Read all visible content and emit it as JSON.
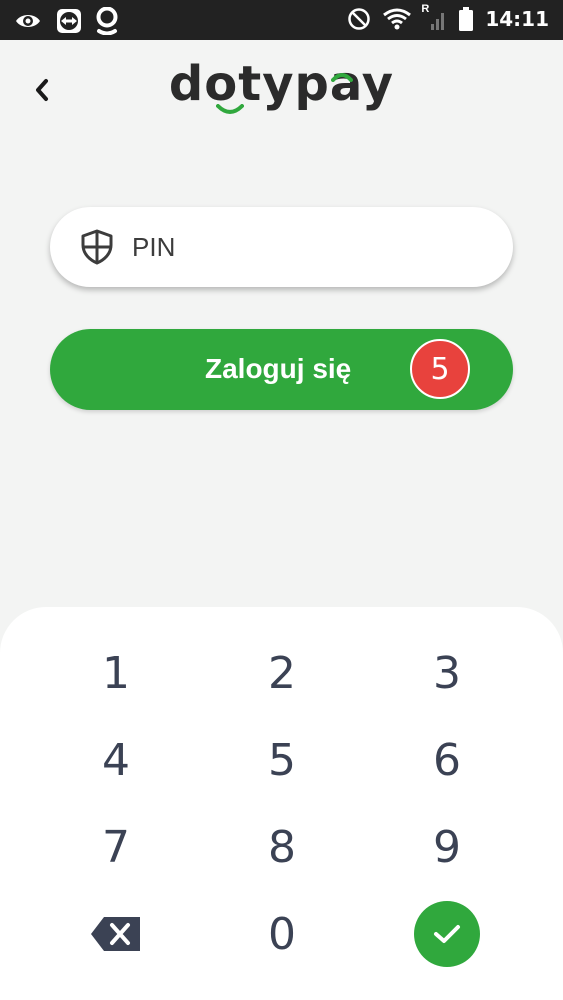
{
  "status_bar": {
    "time": "14:11",
    "left_icons": [
      "eye-icon",
      "teamviewer-icon",
      "location-icon"
    ],
    "right_icons": [
      "do-not-disturb-icon",
      "wifi-icon",
      "signal-icon",
      "battery-icon"
    ],
    "roaming_indicator": "R"
  },
  "header": {
    "logo_text": "dotypay",
    "back_icon": "chevron-left-icon"
  },
  "pin_field": {
    "placeholder": "PIN",
    "value": "",
    "icon": "shield-icon"
  },
  "login_button": {
    "label": "Zaloguj się",
    "badge_count": "5"
  },
  "keypad": {
    "keys": [
      "1",
      "2",
      "3",
      "4",
      "5",
      "6",
      "7",
      "8",
      "9"
    ],
    "zero": "0",
    "backspace_icon": "backspace-icon",
    "confirm_icon": "check-icon"
  },
  "colors": {
    "accent_green": "#30a83d",
    "badge_red": "#e8423d",
    "key_text": "#3b4254",
    "background": "#f3f4f3"
  }
}
